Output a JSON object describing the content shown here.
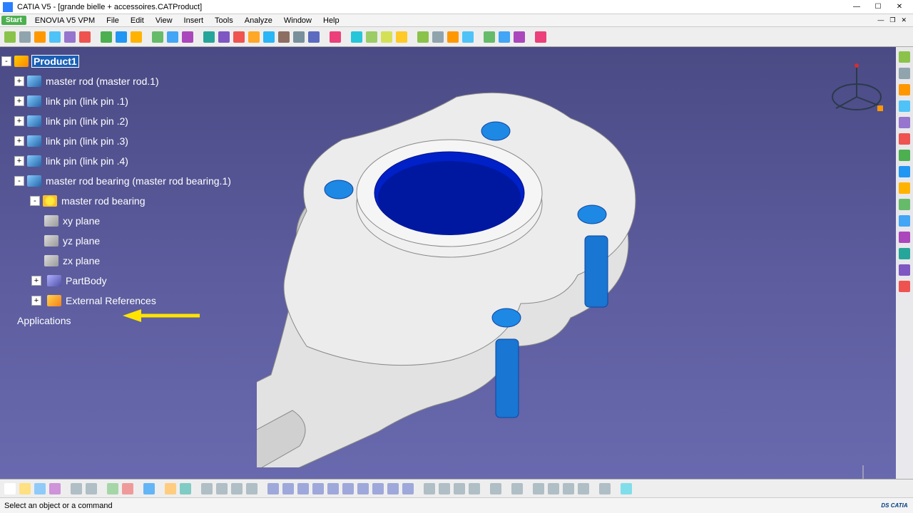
{
  "app": {
    "name": "CATIA V5",
    "document_title": "[grande bielle + accessoires.CATProduct]"
  },
  "menus": {
    "start": "Start",
    "items": [
      "ENOVIA V5 VPM",
      "File",
      "Edit",
      "View",
      "Insert",
      "Tools",
      "Analyze",
      "Window",
      "Help"
    ]
  },
  "tree": {
    "root": "Product1",
    "items": [
      {
        "label": "master rod (master rod.1)",
        "icon": "part"
      },
      {
        "label": "link pin  (link pin .1)",
        "icon": "part"
      },
      {
        "label": "link pin  (link pin .2)",
        "icon": "part"
      },
      {
        "label": "link pin  (link pin .3)",
        "icon": "part"
      },
      {
        "label": "link pin  (link pin .4)",
        "icon": "part"
      },
      {
        "label": "master rod bearing (master rod bearing.1)",
        "icon": "part",
        "expanded": true,
        "children": [
          {
            "label": "master rod bearing",
            "icon": "gear",
            "expanded": true,
            "children": [
              {
                "label": "xy plane",
                "icon": "plane"
              },
              {
                "label": "yz plane",
                "icon": "plane"
              },
              {
                "label": "zx plane",
                "icon": "plane"
              },
              {
                "label": "PartBody",
                "icon": "body",
                "highlight_arrow": true
              },
              {
                "label": "External References",
                "icon": "extref"
              }
            ]
          }
        ]
      }
    ],
    "applications": "Applications"
  },
  "statusbar": {
    "prompt": "Select an object or a command"
  },
  "colors": {
    "viewport_bg_top": "#4a4a85",
    "viewport_bg_bot": "#6a6ab0",
    "part_body": "#e8e8e8",
    "part_hole": "#0020c0",
    "pins": "#1e88e5",
    "arrow": "#ffe400"
  },
  "toolbar_top": {
    "groups": [
      [
        "#8bc34a",
        "#90a4ae",
        "#ff9800",
        "#4fc3f7",
        "#9575cd",
        "#ef5350"
      ],
      [
        "#4caf50",
        "#2196f3",
        "#ffb300"
      ],
      [
        "#66bb6a",
        "#42a5f5",
        "#ab47bc"
      ],
      [
        "#26a69a",
        "#7e57c2",
        "#ef5350",
        "#ffa726",
        "#29b6f6",
        "#8d6e63",
        "#78909c",
        "#5c6bc0"
      ],
      [
        "#ec407a"
      ],
      [
        "#26c6da",
        "#9ccc65",
        "#d4e157",
        "#ffca28"
      ],
      [
        "#8bc34a",
        "#90a4ae",
        "#ff9800",
        "#4fc3f7"
      ],
      [
        "#66bb6a",
        "#42a5f5",
        "#ab47bc"
      ],
      [
        "#ec407a"
      ]
    ]
  },
  "toolbar_right": [
    "#8bc34a",
    "#90a4ae",
    "#ff9800",
    "#4fc3f7",
    "#9575cd",
    "#ef5350",
    "#4caf50",
    "#2196f3",
    "#ffb300",
    "#66bb6a",
    "#42a5f5",
    "#ab47bc",
    "#26a69a",
    "#7e57c2",
    "#ef5350"
  ],
  "toolbar_bottom": {
    "groups": [
      [
        "#fff",
        "#ffe082",
        "#90caf9",
        "#ce93d8"
      ],
      [
        "#b0bec5",
        "#b0bec5"
      ],
      [
        "#a5d6a7",
        "#ef9a9a"
      ],
      [
        "#64b5f6"
      ],
      [
        "#ffcc80",
        "#80cbc4"
      ],
      [
        "#b0bec5",
        "#b0bec5",
        "#b0bec5",
        "#b0bec5"
      ],
      [
        "#9fa8da",
        "#9fa8da",
        "#9fa8da",
        "#9fa8da",
        "#9fa8da",
        "#9fa8da",
        "#9fa8da",
        "#9fa8da",
        "#9fa8da",
        "#9fa8da"
      ],
      [
        "#b0bec5",
        "#b0bec5",
        "#b0bec5",
        "#b0bec5"
      ],
      [
        "#b0bec5"
      ],
      [
        "#b0bec5"
      ],
      [
        "#b0bec5",
        "#b0bec5",
        "#b0bec5",
        "#b0bec5"
      ],
      [
        "#b0bec5"
      ],
      [
        "#80deea"
      ]
    ]
  }
}
